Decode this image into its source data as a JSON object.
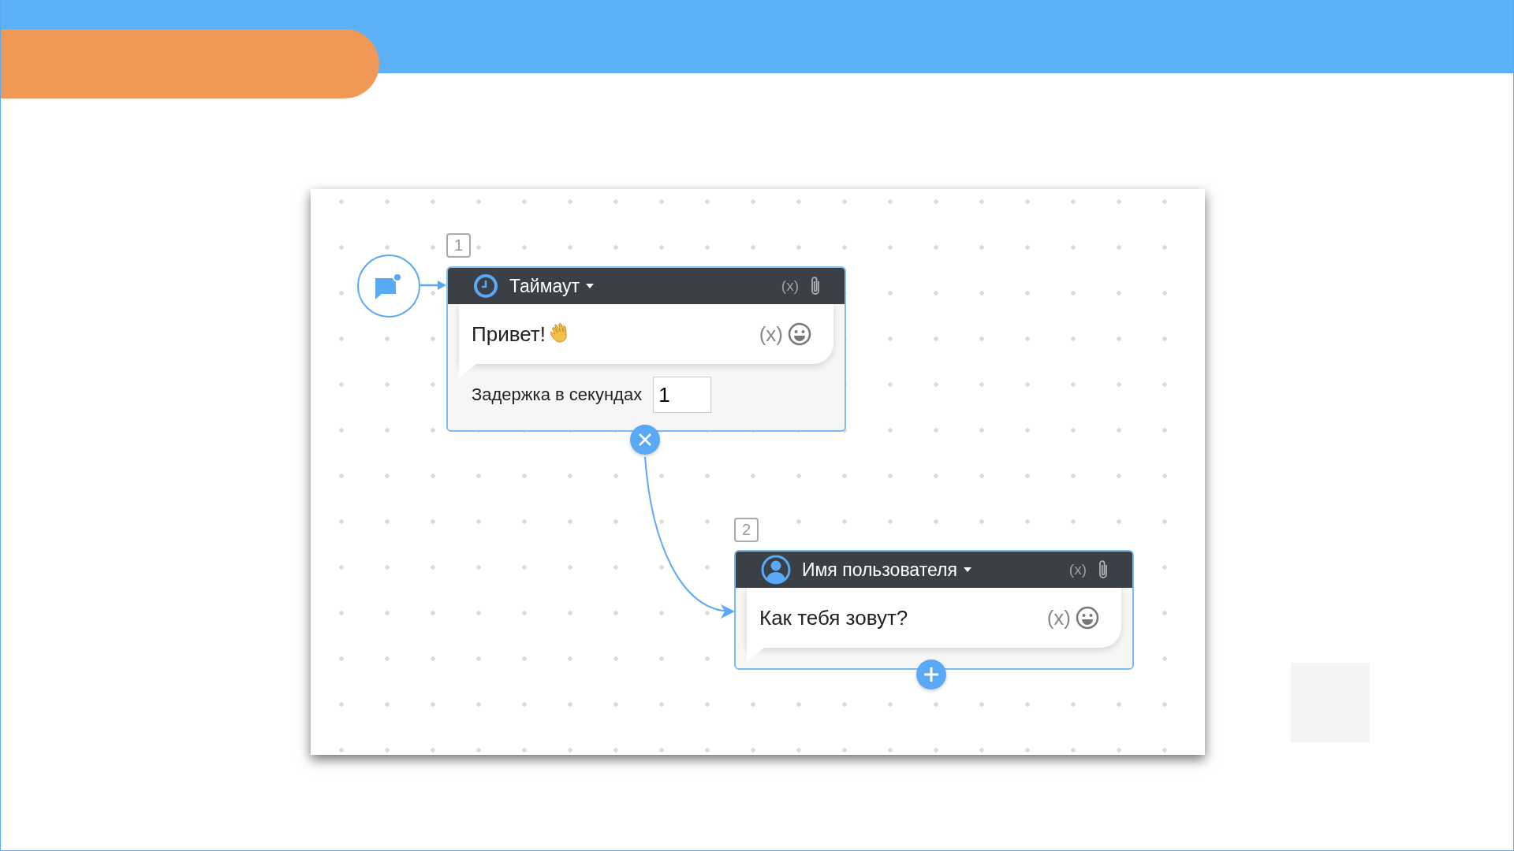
{
  "nodes": [
    {
      "kind": "timeout",
      "number": "1",
      "title": "Таймаут",
      "header_variable": "(x)",
      "message": "Привет!",
      "message_variable": "(x)",
      "delay_label": "Задержка в секундах",
      "delay_value": "1"
    },
    {
      "kind": "question",
      "number": "2",
      "title": "Имя пользователя",
      "header_variable": "(x)",
      "message": "Как тебя зовут?",
      "message_variable": "(x)"
    }
  ]
}
